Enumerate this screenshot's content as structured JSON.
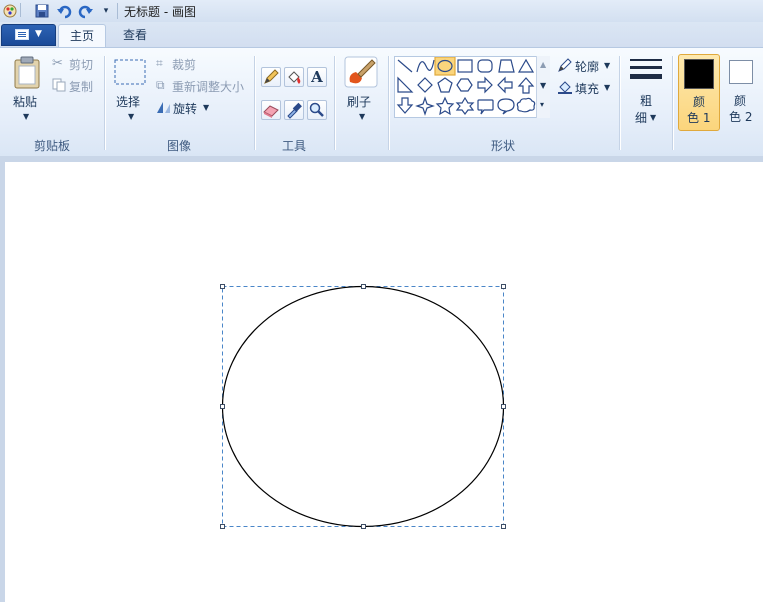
{
  "window": {
    "title": "无标题 - 画图"
  },
  "tabs": [
    {
      "label": "主页"
    },
    {
      "label": "查看"
    }
  ],
  "ribbon": {
    "clipboard": {
      "label": "剪贴板",
      "paste": "粘贴",
      "cut": "剪切",
      "copy": "复制"
    },
    "image": {
      "label": "图像",
      "select": "选择",
      "crop": "裁剪",
      "resize": "重新调整大小",
      "rotate": "旋转"
    },
    "tools": {
      "label": "工具"
    },
    "brushes": {
      "label": "刷子"
    },
    "shapes": {
      "label": "形状",
      "outline": "轮廓",
      "fill": "填充"
    },
    "size": {
      "label_line1": "粗",
      "label_line2": "细"
    },
    "colors": {
      "color1_line1": "颜",
      "color1_line2": "色 1",
      "color2_line1": "颜",
      "color2_line2": "色 2",
      "color1_value": "#000000",
      "color2_value": "#ffffff"
    }
  },
  "canvas": {
    "shape": "ellipse",
    "selection": "dashed-bounding-box"
  }
}
